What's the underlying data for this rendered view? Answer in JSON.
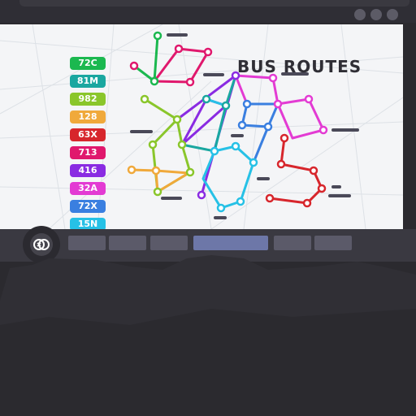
{
  "title": "BUS ROUTES",
  "routes": [
    {
      "label": "72C",
      "color": "#1bb84f"
    },
    {
      "label": "81M",
      "color": "#1aa7a0"
    },
    {
      "label": "982",
      "color": "#8ac62b"
    },
    {
      "label": "128",
      "color": "#f0a93b"
    },
    {
      "label": "63X",
      "color": "#d7262c"
    },
    {
      "label": "713",
      "color": "#e0186d"
    },
    {
      "label": "416",
      "color": "#8a2be2"
    },
    {
      "label": "32A",
      "color": "#e33bd3"
    },
    {
      "label": "72X",
      "color": "#3a7fe0"
    },
    {
      "label": "15N",
      "color": "#26c1e6"
    }
  ],
  "tabs": [
    "",
    "",
    "",
    "",
    "",
    ""
  ],
  "icons": {
    "logo": "bus-logo-icon",
    "window_buttons": [
      "dot-icon",
      "dot-icon",
      "dot-icon"
    ]
  }
}
